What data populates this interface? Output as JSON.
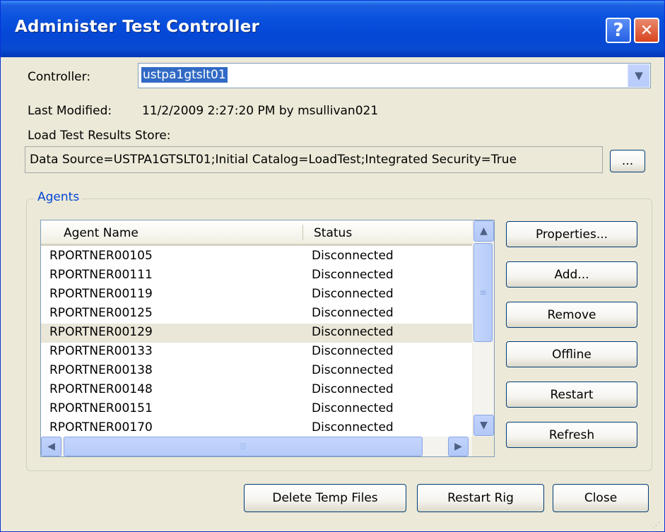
{
  "window": {
    "title": "Administer Test Controller"
  },
  "title_buttons": {
    "help": "?",
    "close": "✕"
  },
  "controller": {
    "label": "Controller:",
    "value": "ustpa1gtslt01",
    "arrow": "▼"
  },
  "last_modified": {
    "label": "Last Modified:",
    "value": "11/2/2009 2:27:20 PM by msullivan021"
  },
  "store": {
    "label": "Load Test Results Store:",
    "value": "Data Source=USTPA1GTSLT01;Initial Catalog=LoadTest;Integrated Security=True",
    "browse_label": "..."
  },
  "agents": {
    "group_label": "Agents",
    "columns": [
      "Agent Name",
      "Status"
    ],
    "rows": [
      {
        "name": "RPORTNER00105",
        "status": "Disconnected"
      },
      {
        "name": "RPORTNER00111",
        "status": "Disconnected"
      },
      {
        "name": "RPORTNER00119",
        "status": "Disconnected"
      },
      {
        "name": "RPORTNER00125",
        "status": "Disconnected"
      },
      {
        "name": "RPORTNER00129",
        "status": "Disconnected"
      },
      {
        "name": "RPORTNER00133",
        "status": "Disconnected"
      },
      {
        "name": "RPORTNER00138",
        "status": "Disconnected"
      },
      {
        "name": "RPORTNER00148",
        "status": "Disconnected"
      },
      {
        "name": "RPORTNER00151",
        "status": "Disconnected"
      },
      {
        "name": "RPORTNER00170",
        "status": "Disconnected"
      }
    ],
    "selected_row": "RPORTNER00129",
    "buttons": {
      "properties": "Properties...",
      "add": "Add...",
      "remove": "Remove",
      "offline": "Offline",
      "restart": "Restart",
      "refresh": "Refresh"
    }
  },
  "footer": {
    "delete_temp": "Delete Temp Files",
    "restart_rig": "Restart Rig",
    "close": "Close"
  },
  "colors": {
    "title_bar": "#0a52df",
    "selection": "#316ac5",
    "group_label": "#0046d5",
    "dialog_bg": "#ece9d8"
  }
}
